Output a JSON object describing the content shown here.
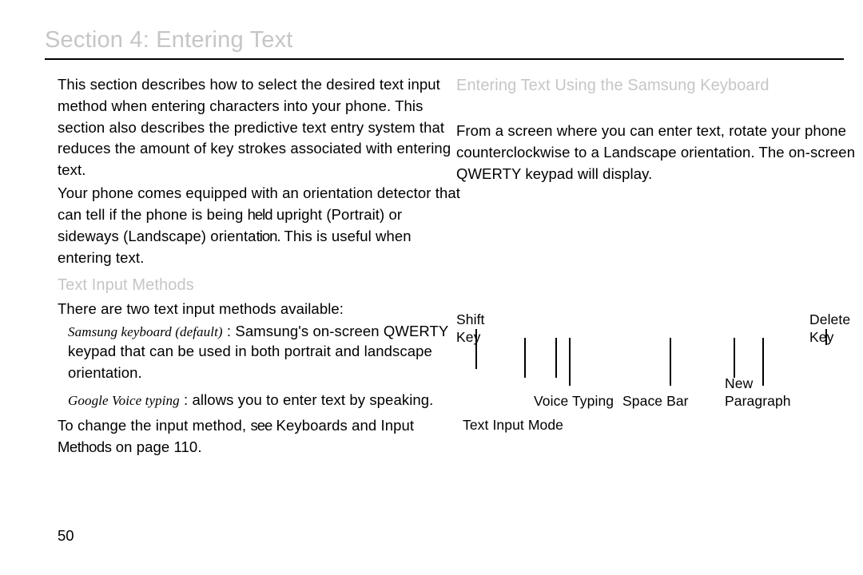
{
  "title": "Section 4: Entering Text",
  "intro_para": "This section describes how to select the desired text input method when entering characters into your phone. This section also describes the predictive text entry system that reduces the amount of key strokes associated with entering text.",
  "orientation_line1": "Your phone comes equipped with an orientation detector that",
  "orientation_line2a": "can tell if the phone is being",
  "orientation_line2b": "held",
  "orientation_line2c": "upright (Portrait) or",
  "orientation_line3a": "sideways (Landscape) orienta",
  "orientation_line3b": "tion.",
  "orientation_line3c": "This is useful when",
  "orientation_line4": "entering text.",
  "methods_heading": "Text Input Methods",
  "methods_intro": "There are two text input methods available:",
  "method1_name": "Samsung keyboard (default)",
  "method1_sep": ":",
  "method1_rest": "Samsung's on-screen QWERTY",
  "method1_cont": "keypad that can be used in both portrait and landscape orientation.",
  "method2_name": "Google Voice typing",
  "method2_rest": ": allows you to enter text by speaking.",
  "change_line_a": "To change the input method,",
  "change_line_b": "see",
  "change_line_c": "Keyboards and Input",
  "change_line2a": "Methods",
  "change_line2b": "on page 110.",
  "right_heading": "Entering Text Using the Samsung Keyboard",
  "right_para": "From a screen where you can enter text, rotate your phone counterclockwise to a Landscape orientation. The on-screen QWERTY keypad will display.",
  "labels": {
    "shift": "Shift Key",
    "delete": "Delete Key",
    "voice": "Voice Typing",
    "space": "Space Bar",
    "newpara": "New Paragraph",
    "mode": "Text Input Mode"
  },
  "page_number": "50"
}
